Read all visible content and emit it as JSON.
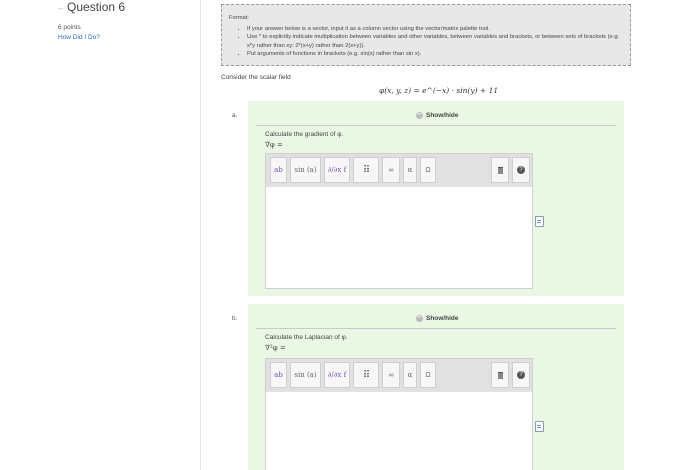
{
  "sidebar": {
    "question_title": "Question 6",
    "points": "6 points",
    "how_did_i_do": "How Did I Do?"
  },
  "format": {
    "heading": "Format:",
    "items": [
      "If your answer below is a vector, input it as a column vector using the vector/matrix palette tool.",
      "Use * to explicitly indicate multiplication between variables and other variables, between variables and brackets, or between sets of brackets (e.g. x*y rather than xy; 2*(x+y) rather than 2(x+y)).",
      "Put arguments of functions in brackets (e.g. sin(x) rather than sin x)."
    ]
  },
  "consider_text": "Consider the scalar field",
  "field_equation": "φ(x, y, z) = e^(−x) · sin(y) + 11",
  "parts": [
    {
      "letter": "a.",
      "showhide": "Show/hide",
      "prompt": "Calculate the gradient of φ.",
      "lhs": "∇φ ="
    },
    {
      "letter": "b.",
      "showhide": "Show/hide",
      "prompt": "Calculate the Laplacian of φ.",
      "lhs": "∇²φ ="
    }
  ],
  "toolbar": {
    "superscript": "ab",
    "sin": "sin (a)",
    "partial": "∂/∂x f",
    "infinity": "∞",
    "alpha": "α",
    "omega": "Ω",
    "trash": "trash-icon",
    "help": "?"
  }
}
